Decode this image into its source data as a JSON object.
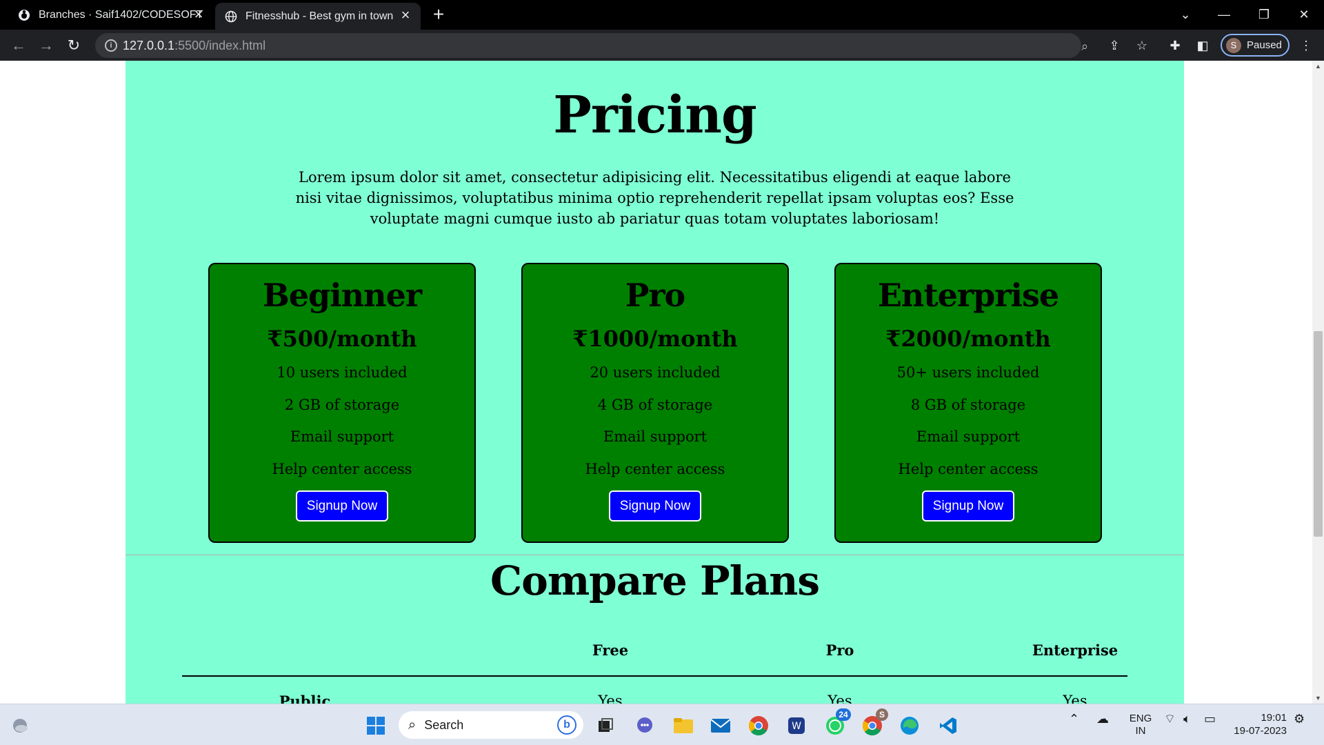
{
  "browser": {
    "tabs": [
      {
        "title": "Branches · Saif1402/CODESOFT",
        "active": false
      },
      {
        "title": "Fitnesshub - Best gym in town",
        "active": true
      }
    ],
    "url_host": "127.0.0.1",
    "url_path": ":5500/index.html",
    "profile_initial": "S",
    "profile_status": "Paused"
  },
  "page": {
    "background": "#7fffd4",
    "pricing_title": "Pricing",
    "pricing_description": "Lorem ipsum dolor sit amet, consectetur adipisicing elit. Necessitatibus eligendi at eaque labore nisi vitae dignissimos, voluptatibus minima optio reprehenderit repellat ipsam voluptas eos? Esse voluptate magni cumque iusto ab pariatur quas totam voluptates laboriosam!",
    "card_color": "#008000",
    "button_color": "#0000ff",
    "plans": [
      {
        "name": "Beginner",
        "price": "₹500/month",
        "features": [
          "10 users included",
          "2 GB of storage",
          "Email support",
          "Help center access"
        ],
        "button": "Signup Now"
      },
      {
        "name": "Pro",
        "price": "₹1000/month",
        "features": [
          "20 users included",
          "4 GB of storage",
          "Email support",
          "Help center access"
        ],
        "button": "Signup Now"
      },
      {
        "name": "Enterprise",
        "price": "₹2000/month",
        "features": [
          "50+ users included",
          "8 GB of storage",
          "Email support",
          "Help center access"
        ],
        "button": "Signup Now"
      }
    ],
    "compare_title": "Compare Plans",
    "compare_headers": [
      "",
      "Free",
      "Pro",
      "Enterprise"
    ],
    "compare_rows": [
      [
        "Public",
        "Yes",
        "Yes",
        "Yes"
      ]
    ]
  },
  "taskbar": {
    "search_placeholder": "Search",
    "whatsapp_badge": "24",
    "chrome_badge": "S",
    "language": "ENG",
    "region": "IN",
    "time": "19:01",
    "date": "19-07-2023"
  }
}
